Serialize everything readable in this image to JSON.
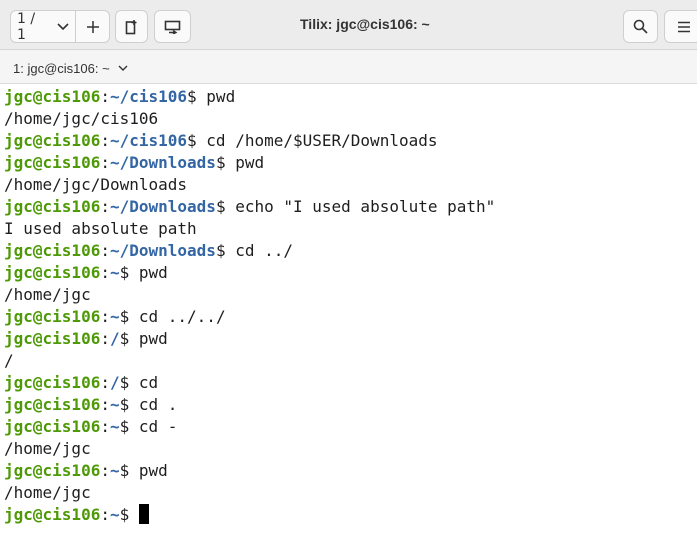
{
  "window": {
    "title": "Tilix: jgc@cis106: ~"
  },
  "toolbar": {
    "session_counter": "1 / 1",
    "icons": {
      "session_dropdown": "chevron-down-icon",
      "add_session": "plus-icon",
      "add_terminal": "add-terminal-icon",
      "sync_input": "sync-input-icon",
      "search": "search-icon",
      "menu": "hamburger-menu-icon"
    }
  },
  "tabs": [
    {
      "label": "1: jgc@cis106: ~"
    }
  ],
  "colors": {
    "user_host": "#4e9a06",
    "path": "#3465a4",
    "text": "#1e1e1e",
    "background": "#ffffff"
  },
  "terminal": {
    "lines": [
      {
        "kind": "prompt",
        "user": "jgc@cis106",
        "path": "~/cis106",
        "command": "pwd"
      },
      {
        "kind": "output",
        "text": "/home/jgc/cis106"
      },
      {
        "kind": "prompt",
        "user": "jgc@cis106",
        "path": "~/cis106",
        "command": "cd /home/$USER/Downloads"
      },
      {
        "kind": "prompt",
        "user": "jgc@cis106",
        "path": "~/Downloads",
        "command": "pwd"
      },
      {
        "kind": "output",
        "text": "/home/jgc/Downloads"
      },
      {
        "kind": "prompt",
        "user": "jgc@cis106",
        "path": "~/Downloads",
        "command": "echo \"I used absolute path\""
      },
      {
        "kind": "output",
        "text": "I used absolute path"
      },
      {
        "kind": "prompt",
        "user": "jgc@cis106",
        "path": "~/Downloads",
        "command": "cd ../"
      },
      {
        "kind": "prompt",
        "user": "jgc@cis106",
        "path": "~",
        "command": "pwd"
      },
      {
        "kind": "output",
        "text": "/home/jgc"
      },
      {
        "kind": "prompt",
        "user": "jgc@cis106",
        "path": "~",
        "command": "cd ../../"
      },
      {
        "kind": "prompt",
        "user": "jgc@cis106",
        "path": "/",
        "command": "pwd"
      },
      {
        "kind": "output",
        "text": "/"
      },
      {
        "kind": "prompt",
        "user": "jgc@cis106",
        "path": "/",
        "command": "cd"
      },
      {
        "kind": "prompt",
        "user": "jgc@cis106",
        "path": "~",
        "command": "cd ."
      },
      {
        "kind": "prompt",
        "user": "jgc@cis106",
        "path": "~",
        "command": "cd -"
      },
      {
        "kind": "output",
        "text": "/home/jgc"
      },
      {
        "kind": "prompt",
        "user": "jgc@cis106",
        "path": "~",
        "command": "pwd"
      },
      {
        "kind": "output",
        "text": "/home/jgc"
      },
      {
        "kind": "prompt",
        "user": "jgc@cis106",
        "path": "~",
        "command": "",
        "cursor": true
      }
    ]
  }
}
